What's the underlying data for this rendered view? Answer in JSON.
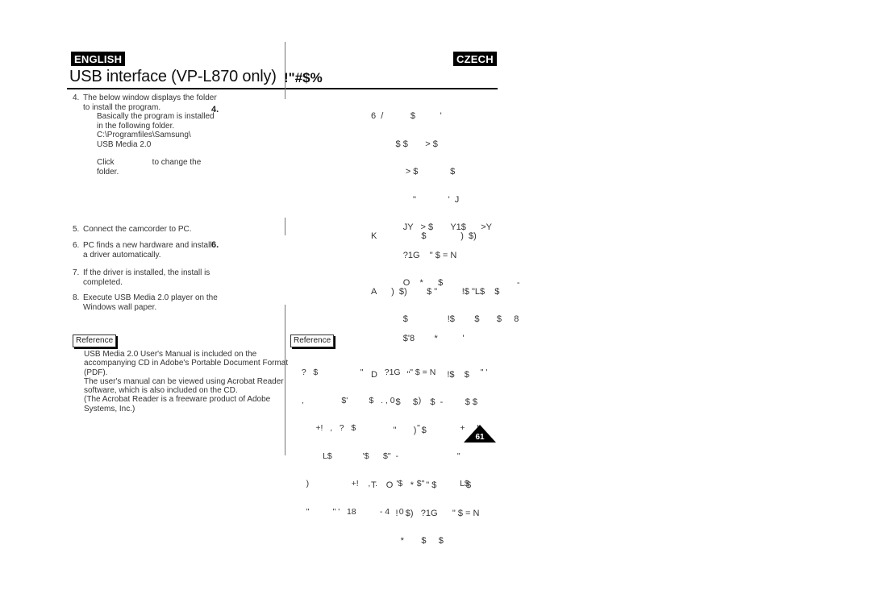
{
  "header": {
    "lang_left": "ENGLISH",
    "lang_right": "CZECH",
    "title_en": "USB interface (VP-L870 only)",
    "title_cz": "!\"#$%"
  },
  "english": {
    "step4": {
      "num": "4.",
      "lines": [
        "The below window displays the folder",
        "to install the program."
      ],
      "sub_lines": [
        "Basically the program is installed",
        "in the following folder.",
        "C:\\Programfiles\\Samsung\\",
        "USB Media 2.0"
      ],
      "click_label": "Click",
      "click_suffix": "to change the",
      "click_line2": "folder."
    },
    "step5": {
      "num": "5.",
      "lines": [
        "Connect the camcorder to PC."
      ]
    },
    "step6": {
      "num": "6.",
      "lines": [
        "PC finds a new hardware and install",
        "a driver automatically."
      ]
    },
    "step7": {
      "num": "7.",
      "lines": [
        "If the driver is installed, the install is",
        "completed."
      ]
    },
    "step8": {
      "num": "8.",
      "lines": [
        "Execute USB Media 2.0 player on the",
        "Windows wall paper."
      ]
    },
    "reference_label": "Reference",
    "reference_lines": [
      "USB Media 2.0 User's Manual is included on the",
      "accompanying CD in Adobe's Portable Document Format",
      "(PDF).",
      "The user's manual can be viewed using Acrobat Reader",
      "software, which is also included on the CD.",
      "(The Acrobat Reader is a freeware product of Adobe",
      "Systems, Inc.)"
    ]
  },
  "screenshot_markers": {
    "marker_4": "4.",
    "marker_6": "6."
  },
  "czech": {
    "block1": [
      "6  /           $          '",
      "          $ $       > $",
      "              > $             $",
      "                 \"             '  J",
      "             JY   > $       Y1$      >Y",
      "             ?1G    \" $ = N",
      "             O    *      $                              -",
      "",
      "             $'8        *          '"
    ],
    "block2": [
      "K                  $              )  $)",
      "",
      "A      )  $)        $ \"          !$ \"L$    $",
      "             $                !$        $       $     8",
      "",
      "D            \"               !$    $",
      "          $     $     $  -         $ $",
      "         \"       )  $",
      "",
      "T    O       *     \" $            $",
      "          !   $)   ?1G      \" $ = N",
      "            *       $     $"
    ],
    "reference_label": "Reference",
    "reference_lines": [
      "  ?   $                  \"         ?1G    \" $ = N                   \" '",
      "  ,                $'         $   . , 0          )",
      "        +!   ,   ?   $                          \"                 +     !",
      "           L$             '$      $\"  -                         \"",
      "    )                  +!    ,  .        '$      $\"               L$",
      "    \"          \" '   18          - 4    0"
    ]
  },
  "footer": {
    "page_number": "61"
  }
}
